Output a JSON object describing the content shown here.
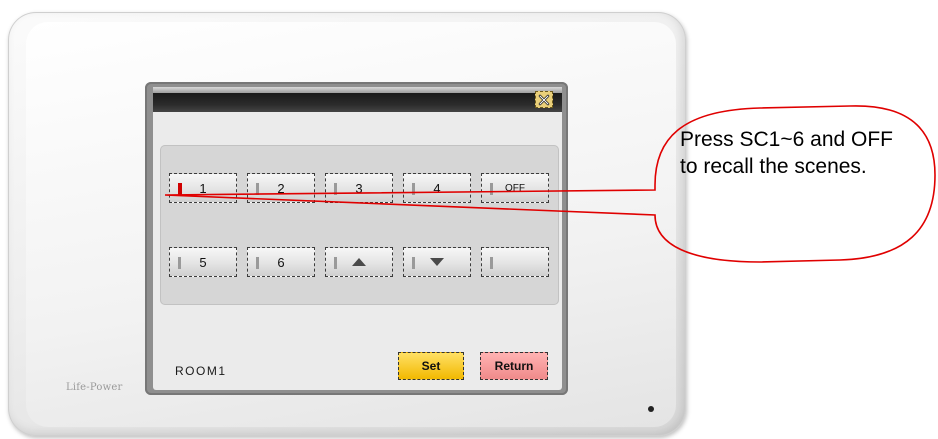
{
  "device": {
    "brand": "Life-Power"
  },
  "screen": {
    "scene_buttons_row1": [
      {
        "label": "1",
        "active": true
      },
      {
        "label": "2",
        "active": false
      },
      {
        "label": "3",
        "active": false
      },
      {
        "label": "4",
        "active": false
      },
      {
        "label": "OFF",
        "active": false
      }
    ],
    "scene_buttons_row2": [
      {
        "label": "5"
      },
      {
        "label": "6"
      },
      {
        "label": "",
        "icon": "triangle-up-icon"
      },
      {
        "label": "",
        "icon": "triangle-down-icon"
      },
      {
        "label": ""
      }
    ],
    "room_label": "ROOM1",
    "set_label": "Set",
    "return_label": "Return",
    "close_icon": "close-icon"
  },
  "callout": {
    "text": "Press SC1~6 and OFF to recall the scenes."
  },
  "colors": {
    "active_indicator": "#d00000",
    "set_button": "#f2b900",
    "return_button": "#f08a8a",
    "callout_outline": "#e00000"
  }
}
